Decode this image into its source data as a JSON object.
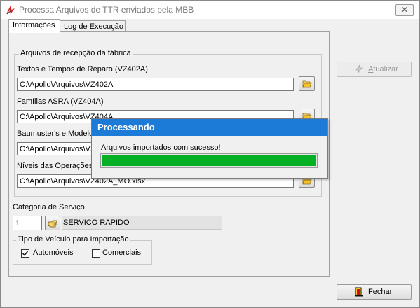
{
  "window": {
    "title": "Processa Arquivos de TTR enviados pela MBB",
    "close_glyph": "✕"
  },
  "tabs": [
    {
      "label": "Informações",
      "active": true
    },
    {
      "label": "Log de Execução",
      "active": false
    }
  ],
  "files_group": {
    "legend": "Arquivos de recepção da fábrica",
    "fields": [
      {
        "label": "Textos e Tempos de Reparo (VZ402A)",
        "value": "C:\\Apollo\\Arquivos\\VZ402A"
      },
      {
        "label": "Famílias ASRA (VZ404A)",
        "value": "C:\\Apollo\\Arquivos\\VZ404A"
      },
      {
        "label": "Baumuster's e Modelos",
        "value": "C:\\Apollo\\Arquivos\\VZ"
      },
      {
        "label": "Níveis das Operações",
        "value": "C:\\Apollo\\Arquivos\\VZ402A_MO.xlsx"
      }
    ]
  },
  "service_category": {
    "label": "Categoria de Serviço",
    "code": "1",
    "description": "SERVICO RAPIDO"
  },
  "vehicle_type": {
    "legend": "Tipo de Veículo para Importação",
    "options": [
      {
        "label": "Automóveis",
        "checked": true
      },
      {
        "label": "Comerciais",
        "checked": false
      }
    ]
  },
  "buttons": {
    "update": "Atualizar",
    "close": "Fechar"
  },
  "dialog": {
    "title": "Processando",
    "message": "Arquivos importados com sucesso!",
    "progress": 1.0,
    "progress_color": "#06b025"
  },
  "colors": {
    "dialog_title_bg": "#1c7bd6",
    "app_icon": "#e02020"
  }
}
